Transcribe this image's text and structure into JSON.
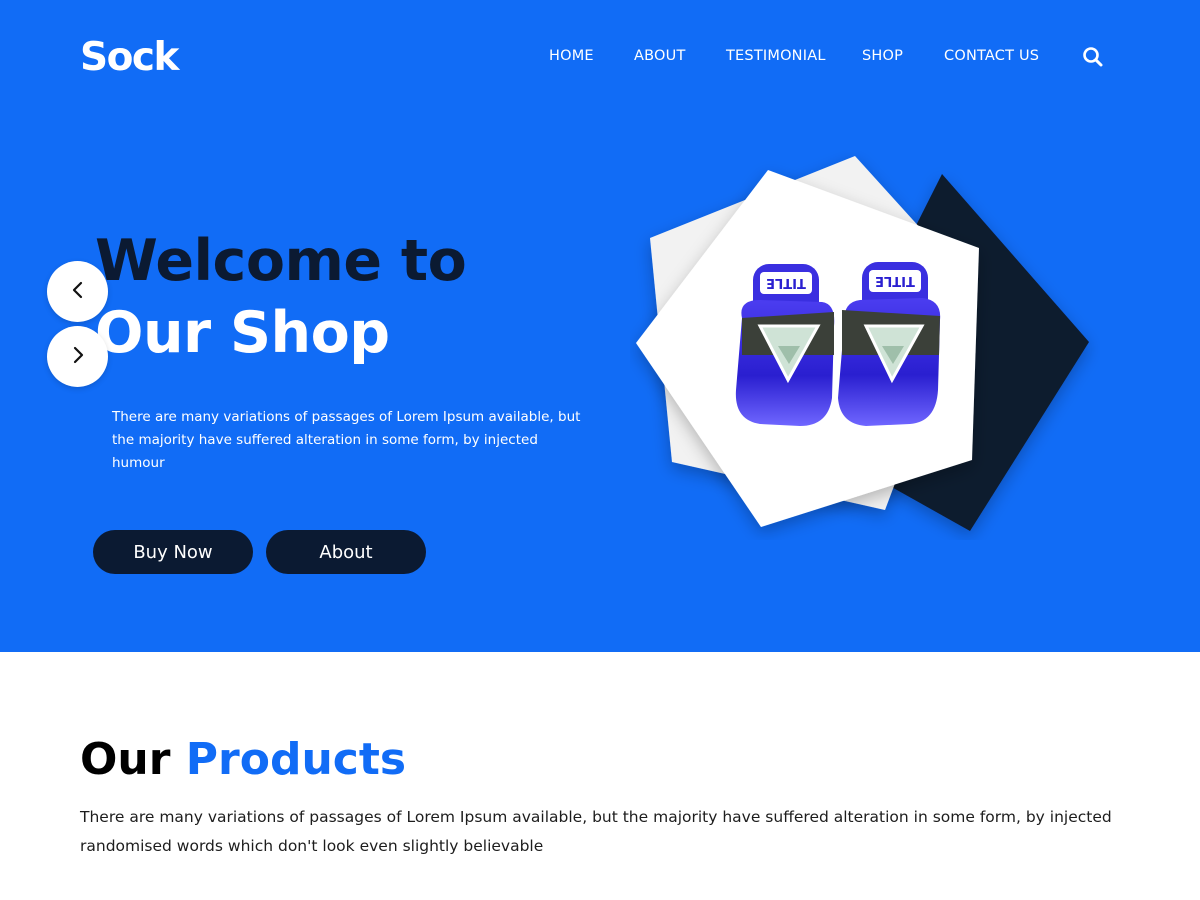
{
  "brand": {
    "logo": "Sock",
    "colors": {
      "primary_blue": "#116cf6",
      "dark_navy": "#0b1a32",
      "white": "#ffffff"
    }
  },
  "nav": {
    "items": [
      {
        "label": "HOME"
      },
      {
        "label": "ABOUT"
      },
      {
        "label": "TESTIMONIAL"
      },
      {
        "label": "SHOP"
      },
      {
        "label": "CONTACT US"
      }
    ],
    "search_icon": "search-icon"
  },
  "hero": {
    "headline_line1": "Welcome to",
    "headline_line2": "Our Shop",
    "description": "There are many variations of passages of Lorem Ipsum available, but the majority have suffered alteration in some form, by injected humour",
    "buttons": {
      "buy_now": "Buy Now",
      "about": "About"
    },
    "slider": {
      "prev_icon": "chevron-left-icon",
      "next_icon": "chevron-right-icon"
    },
    "product_image": {
      "glove_print": "TITLE"
    }
  },
  "products": {
    "title_part1": "Our",
    "title_part2": "Products",
    "description": "There are many variations of passages of Lorem Ipsum available, but the majority have suffered alteration in some form, by injected randomised words which don't look even slightly believable"
  }
}
